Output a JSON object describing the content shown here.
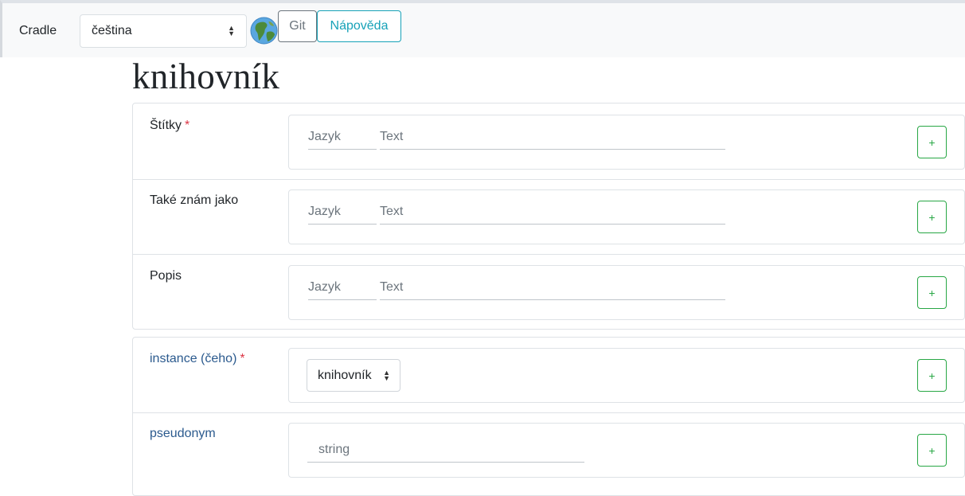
{
  "header": {
    "brand": "Cradle",
    "language_select": {
      "value": "čeština"
    },
    "git_label": "Git",
    "help_label": "Nápověda"
  },
  "page": {
    "title": "knihovník"
  },
  "terms": [
    {
      "label": "Štítky",
      "required": "*",
      "language_placeholder": "Jazyk",
      "text_placeholder": "Text",
      "add_label": "+"
    },
    {
      "label": "Také znám jako",
      "required": "",
      "language_placeholder": "Jazyk",
      "text_placeholder": "Text",
      "add_label": "+"
    },
    {
      "label": "Popis",
      "required": "",
      "language_placeholder": "Jazyk",
      "text_placeholder": "Text",
      "add_label": "+"
    }
  ],
  "statements": [
    {
      "label": "instance (čeho)",
      "required": "*",
      "select_value": "knihovník",
      "add_label": "+"
    },
    {
      "label": "pseudonym",
      "required": "",
      "placeholder": "string",
      "add_label": "+"
    }
  ],
  "icons": {
    "globe": "globe-icon",
    "select_arrows": "select-updown-icon",
    "add": "plus-icon"
  },
  "colors": {
    "header_bg": "#f8f9fa",
    "secondary": "#6c757d",
    "info": "#17a2b8",
    "success": "#28a745",
    "danger": "#dc3545",
    "link": "#2b5a8e"
  }
}
